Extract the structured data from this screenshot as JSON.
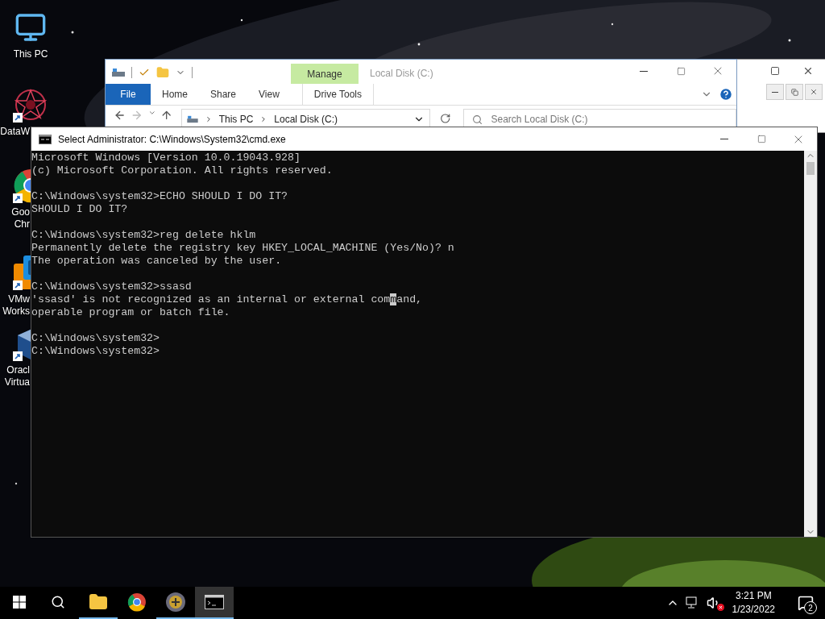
{
  "desktop_icons": [
    {
      "kind": "computer",
      "shortcut": false,
      "lines": [
        "This PC"
      ]
    },
    {
      "kind": "star",
      "shortcut": true,
      "lines": [
        "DataW"
      ]
    },
    {
      "kind": "browser",
      "shortcut": true,
      "lines": [
        "Goo",
        "Chr"
      ]
    },
    {
      "kind": "vm",
      "shortcut": true,
      "lines": [
        "VMw",
        "Works"
      ]
    },
    {
      "kind": "box",
      "shortcut": true,
      "lines": [
        "Oracl",
        "Virtua"
      ]
    }
  ],
  "explorer": {
    "title": "Local Disk (C:)",
    "context_group": "Manage",
    "tabs": [
      {
        "label": "File",
        "kind": "file"
      },
      {
        "label": "Home",
        "kind": "tab"
      },
      {
        "label": "Share",
        "kind": "tab"
      },
      {
        "label": "View",
        "kind": "tab"
      },
      {
        "label": "Drive Tools",
        "kind": "context"
      }
    ],
    "breadcrumb": [
      "This PC",
      "Local Disk (C:)"
    ],
    "search": {
      "placeholder": "Search Local Disk (C:)"
    }
  },
  "console": {
    "title": "Select Administrator: C:\\Windows\\System32\\cmd.exe",
    "blocks": [
      [
        {
          "text": "Microsoft Windows [Version 10.0.19043.928]"
        },
        {
          "text": "(c) Microsoft Corporation. All rights reserved."
        }
      ],
      [
        {
          "text": "C:\\Windows\\system32>ECHO SHOULD I DO IT?"
        },
        {
          "text": "SHOULD I DO IT?"
        }
      ],
      [
        {
          "text": "C:\\Windows\\system32>reg delete hklm"
        },
        {
          "text": "Permanently delete the registry key HKEY_LOCAL_MACHINE (Yes/No)? n"
        },
        {
          "text": "The operation was canceled by the user."
        }
      ],
      [
        {
          "text": "C:\\Windows\\system32>ssasd"
        },
        {
          "before": "'ssasd' is not recognized as an internal or external com",
          "cursor": "m",
          "after": "and,"
        },
        {
          "text": "operable program or batch file."
        }
      ],
      [
        {
          "text": "C:\\Windows\\system32>"
        },
        {
          "text": "C:\\Windows\\system32>"
        }
      ]
    ]
  },
  "taskbar": {
    "apps": [
      {
        "kind": "explorer",
        "running": true,
        "active": false
      },
      {
        "kind": "browser",
        "running": false,
        "active": false
      },
      {
        "kind": "disc",
        "running": true,
        "active": false
      },
      {
        "kind": "console",
        "running": true,
        "active": true
      }
    ],
    "clock": {
      "time": "3:21 PM",
      "date": "1/23/2022"
    },
    "notifications": "2"
  }
}
